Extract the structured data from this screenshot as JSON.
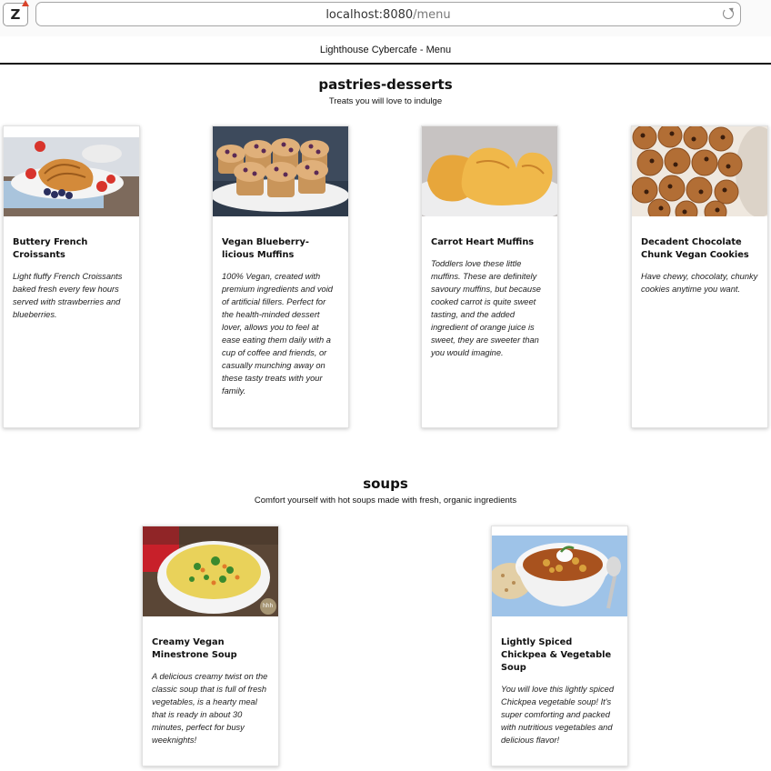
{
  "browser": {
    "url_host": "localhost:8080",
    "url_path": "/menu",
    "extension_letter": "Z"
  },
  "page": {
    "title": "Lighthouse Cybercafe - Menu"
  },
  "sections": [
    {
      "title": "pastries-desserts",
      "subtitle": "Treats you will love to indulge",
      "items": [
        {
          "name": "Buttery French Croissants",
          "description": "Light fluffy French Croissants baked fresh every few hours served with strawberries and blueberries.",
          "image": "croissants-photo"
        },
        {
          "name": "Vegan Blueberry-licious Muffins",
          "description": "100% Vegan, created with premium ingredients and void of artificial fillers. Perfect for the health-minded dessert lover, allows you to feel at ease eating them daily with a cup of coffee and friends, or casually munching away on these tasty treats with your family.",
          "image": "blueberry-muffins-photo"
        },
        {
          "name": "Carrot Heart Muffins",
          "description": "Toddlers love these little muffins. These are definitely savoury muffins, but because cooked carrot is quite sweet tasting, and the added ingredient of orange juice is sweet, they are sweeter than you would imagine.",
          "image": "carrot-heart-muffins-photo"
        },
        {
          "name": "Decadent Chocolate Chunk Vegan Cookies",
          "description": "Have chewy, chocolaty, chunky cookies anytime you want.",
          "image": "chocolate-cookies-photo"
        }
      ]
    },
    {
      "title": "soups",
      "subtitle": "Comfort yourself with hot soups made with fresh, organic ingredients",
      "items": [
        {
          "name": "Creamy Vegan Minestrone Soup",
          "description": "A delicious creamy twist on the classic soup that is full of fresh vegetables, is a hearty meal that is ready in about 30 minutes, perfect for busy weeknights!",
          "image": "minestrone-soup-photo",
          "watermark": "hhh"
        },
        {
          "name": "Lightly Spiced Chickpea & Vegetable Soup",
          "description": "You will love this lightly spiced Chickpea vegetable soup! It's super comforting and packed with nutritious vegetables and delicious flavor!",
          "image": "chickpea-soup-photo"
        }
      ]
    }
  ]
}
